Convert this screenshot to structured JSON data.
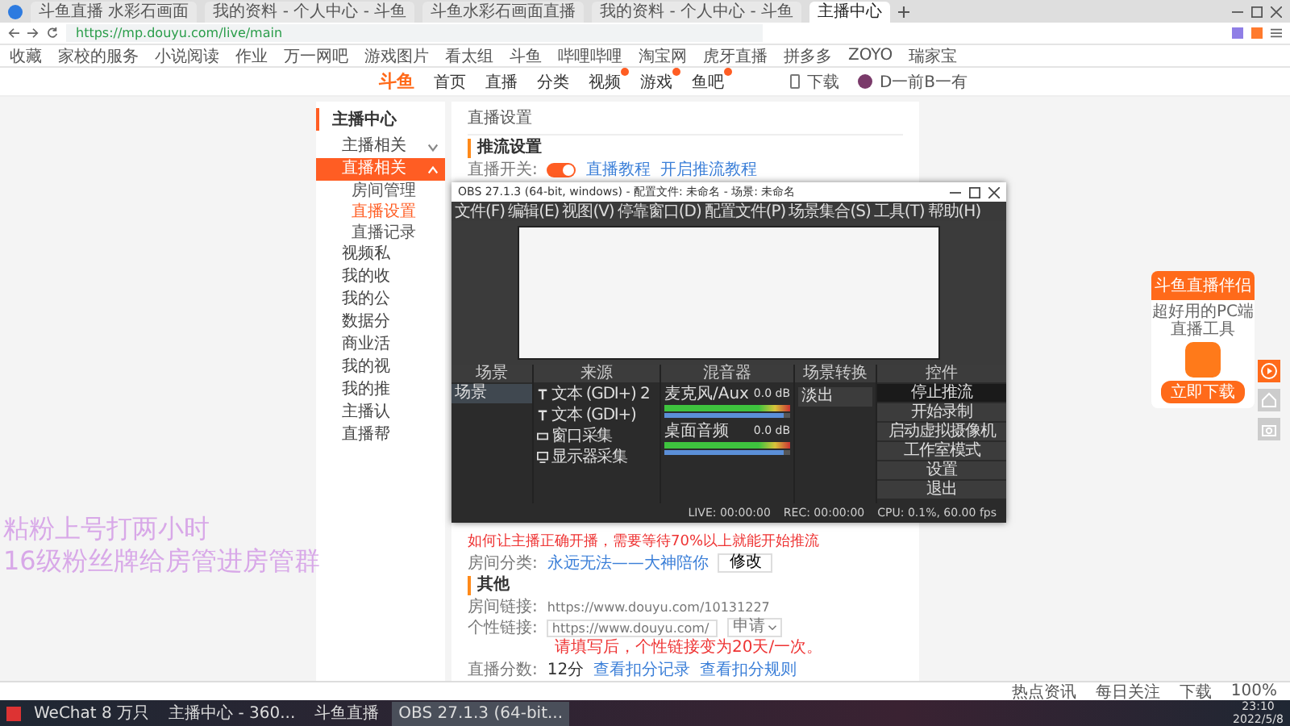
{
  "browser": {
    "tabs": [
      {
        "title": "斗鱼直播 水彩石画面",
        "selected": false
      },
      {
        "title": "我的资料 - 个人中心 - 斗鱼",
        "selected": false
      },
      {
        "title": "斗鱼水彩石画面直播",
        "selected": false
      },
      {
        "title": "我的资料 - 个人中心 - 斗鱼",
        "selected": false
      },
      {
        "title": "主播中心",
        "selected": true
      }
    ],
    "url": "https://mp.douyu.com/live/main",
    "bookmarks": [
      "收藏",
      "家校的服务",
      "小说阅读",
      "作业",
      "万一网吧",
      "游戏图片",
      "看太组",
      "斗鱼",
      "哔哩哔哩",
      "淘宝网",
      "虎牙直播",
      "拼多多",
      "ZOYO",
      "瑞家宝"
    ],
    "status_items": [
      "热点资讯",
      "每日关注",
      "下载",
      "100%"
    ]
  },
  "site_header": {
    "logo": "斗鱼",
    "nav": [
      {
        "label": "首页",
        "badge": false
      },
      {
        "label": "直播",
        "badge": false
      },
      {
        "label": "分类",
        "badge": false
      },
      {
        "label": "视频",
        "badge": true
      },
      {
        "label": "游戏",
        "badge": true
      },
      {
        "label": "鱼吧",
        "badge": true
      }
    ],
    "download": "下载",
    "username": "D一前B一有"
  },
  "sidebar": {
    "title": "主播中心",
    "items": [
      {
        "label": "主播相关",
        "kind": "group",
        "selected": false,
        "expanded": false
      },
      {
        "label": "直播相关",
        "kind": "group",
        "selected": true,
        "expanded": true,
        "children": [
          {
            "label": "房间管理",
            "selected": false
          },
          {
            "label": "直播设置",
            "selected": true
          },
          {
            "label": "直播记录",
            "selected": false
          }
        ]
      },
      {
        "label": "视频私",
        "kind": "link",
        "selected": false
      },
      {
        "label": "我的收",
        "kind": "link",
        "selected": false
      },
      {
        "label": "我的公",
        "kind": "link",
        "selected": false
      },
      {
        "label": "数据分",
        "kind": "link",
        "selected": false
      },
      {
        "label": "商业活",
        "kind": "link",
        "selected": false
      },
      {
        "label": "我的视",
        "kind": "link",
        "selected": false
      },
      {
        "label": "我的推",
        "kind": "link",
        "selected": false
      },
      {
        "label": "主播认",
        "kind": "link",
        "selected": false
      },
      {
        "label": "直播帮",
        "kind": "link",
        "selected": false
      }
    ]
  },
  "page_title": "直播设置",
  "stream_settings": {
    "heading": "推流设置",
    "toggle_label": "直播开关:",
    "toggle_on": true,
    "links": [
      "直播教程",
      "开启推流教程"
    ],
    "note": "如何让主播正确开播，需要等待70%以上就能开始推流",
    "category_label": "房间分类:",
    "category": "永远无法——大神陪你",
    "change_button": "修改"
  },
  "other": {
    "heading": "其他",
    "room_link_label": "房间链接:",
    "room_link": "https://www.douyu.com/10131227",
    "custom_link_label": "个性链接:",
    "custom_link_value": "https://www.douyu.com/",
    "apply": "申请",
    "hint": "请填写后，个性链接变为20天/一次。",
    "score_label": "直播分数:",
    "score": "12分",
    "score_links": [
      "查看扣分记录",
      "查看扣分规则"
    ]
  },
  "obs": {
    "title": "OBS 27.1.3 (64-bit, windows) - 配置文件: 未命名 - 场景: 未命名",
    "menu": [
      "文件(F)",
      "编辑(E)",
      "视图(V)",
      "停靠窗口(D)",
      "配置文件(P)",
      "场景集合(S)",
      "工具(T)",
      "帮助(H)"
    ],
    "scenes": {
      "header": "场景",
      "items": [
        {
          "label": "场景",
          "selected": true
        }
      ]
    },
    "sources": {
      "header": "来源",
      "items": [
        {
          "label": "文本 (GDI+) 2",
          "kind": "text"
        },
        {
          "label": "文本 (GDI+)",
          "kind": "text"
        },
        {
          "label": "窗口采集",
          "kind": "window"
        },
        {
          "label": "显示器采集",
          "kind": "display"
        }
      ]
    },
    "mixer": {
      "header": "混音器",
      "channels": [
        {
          "name": "麦克风/Aux",
          "reading": "0.0 dB",
          "level": 0.95
        },
        {
          "name": "桌面音频",
          "reading": "0.0 dB",
          "level": 0.95
        }
      ]
    },
    "transitions": {
      "header": "场景转换",
      "value": "淡出"
    },
    "controls": {
      "header": "控件",
      "buttons": [
        {
          "label": "停止推流",
          "selected": true
        },
        {
          "label": "开始录制",
          "selected": false
        },
        {
          "label": "启动虚拟摄像机",
          "selected": false
        },
        {
          "label": "工作室模式",
          "selected": false
        },
        {
          "label": "设置",
          "selected": false
        },
        {
          "label": "退出",
          "selected": false
        }
      ]
    },
    "status": [
      "LIVE: 00:00:00",
      "REC: 00:00:00",
      "CPU: 0.1%, 60.00 fps"
    ]
  },
  "promo": {
    "title": "斗鱼直播伴侣",
    "subtitle": "超好用的PC端直播工具",
    "button": "立即下载"
  },
  "overlay_text": [
    "粘粉上号打两小时",
    "16级粉丝牌给房管进房管群"
  ],
  "taskbar": {
    "items": [
      {
        "label": "WeChat 8 万只",
        "selected": false
      },
      {
        "label": "主播中心 - 360...",
        "selected": false
      },
      {
        "label": "斗鱼直播",
        "selected": false
      },
      {
        "label": "OBS 27.1.3 (64-bit...",
        "selected": true
      }
    ],
    "time": "23:10",
    "date": "2022/5/8"
  }
}
